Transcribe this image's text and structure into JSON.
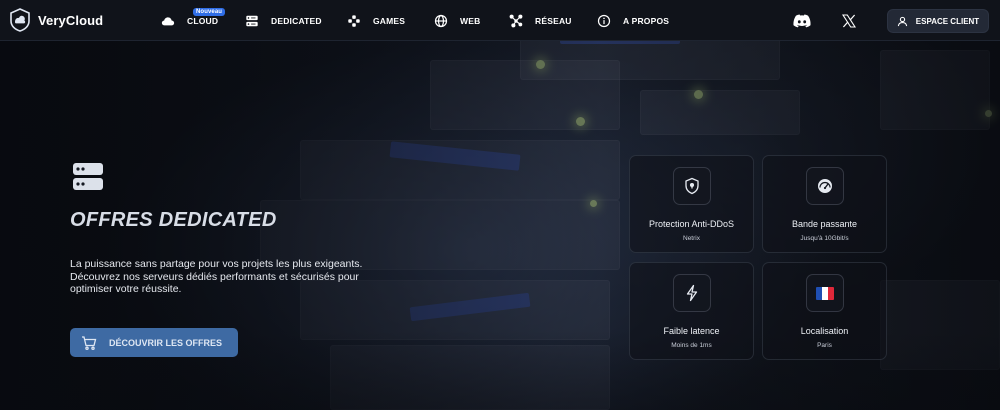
{
  "brand": {
    "name": "VeryCloud"
  },
  "nav": {
    "items": [
      {
        "label": "CLOUD",
        "icon": "cloud-icon",
        "badge": "Nouveau"
      },
      {
        "label": "DEDICATED",
        "icon": "server-icon"
      },
      {
        "label": "GAMES",
        "icon": "gamepad-icon"
      },
      {
        "label": "WEB",
        "icon": "globe-icon"
      },
      {
        "label": "RÉSEAU",
        "icon": "network-icon"
      },
      {
        "label": "A PROPOS",
        "icon": "info-icon"
      }
    ],
    "social": [
      "discord-icon",
      "x-icon"
    ],
    "client_button": "ESPACE CLIENT"
  },
  "hero": {
    "title": "OFFRES DEDICATED",
    "description": "La puissance sans partage pour vos projets les plus exigeants. Découvrez nos serveurs dédiés performants et sécurisés pour optimiser votre réussite.",
    "cta": "DÉCOUVRIR LES OFFRES"
  },
  "features": [
    {
      "title": "Protection Anti-DDoS",
      "subtitle": "Netrix",
      "icon": "shield-lock-icon"
    },
    {
      "title": "Bande passante",
      "subtitle": "Jusqu'à 10Gbit/s",
      "icon": "speedometer-icon"
    },
    {
      "title": "Faible latence",
      "subtitle": "Moins de 1ms",
      "icon": "lightning-icon"
    },
    {
      "title": "Localisation",
      "subtitle": "Paris",
      "icon": "france-flag-icon"
    }
  ],
  "colors": {
    "accent": "#2f6de6",
    "cta": "#3e6aa3",
    "nav_bg": "#10131a",
    "flag": [
      "#1f4fb3",
      "#ffffff",
      "#e0283a"
    ]
  }
}
